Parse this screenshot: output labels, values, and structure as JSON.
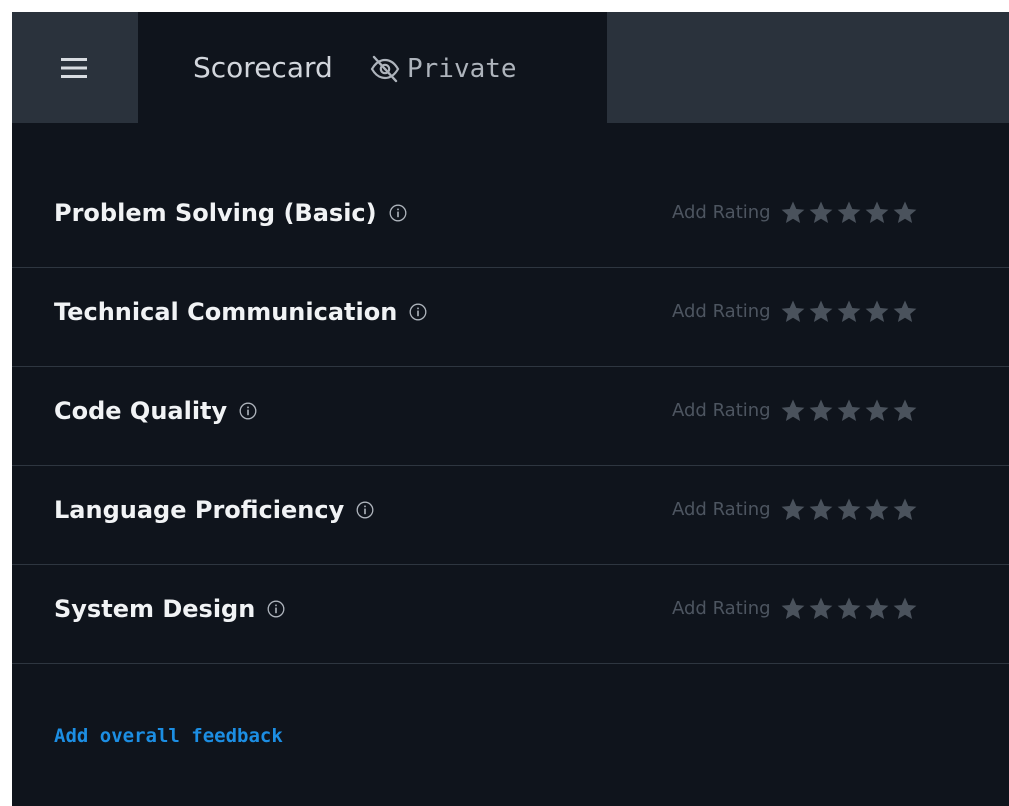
{
  "tab": {
    "title": "Scorecard",
    "privacy_icon": "eye-slash-icon",
    "privacy_label": "Private"
  },
  "menu": {
    "icon": "hamburger-menu-icon"
  },
  "criteria": [
    {
      "label": "Problem Solving (Basic)",
      "rating_label": "Add Rating",
      "rating": 0,
      "max_rating": 5
    },
    {
      "label": "Technical Communication",
      "rating_label": "Add Rating",
      "rating": 0,
      "max_rating": 5
    },
    {
      "label": "Code Quality",
      "rating_label": "Add Rating",
      "rating": 0,
      "max_rating": 5
    },
    {
      "label": "Language Proficiency",
      "rating_label": "Add Rating",
      "rating": 0,
      "max_rating": 5
    },
    {
      "label": "System Design",
      "rating_label": "Add Rating",
      "rating": 0,
      "max_rating": 5
    }
  ],
  "feedback": {
    "link_label": "Add overall feedback"
  },
  "colors": {
    "background": "#0f141c",
    "tabbar": "#2a323c",
    "star_empty": "#4a525c",
    "link": "#1c8ee3"
  }
}
